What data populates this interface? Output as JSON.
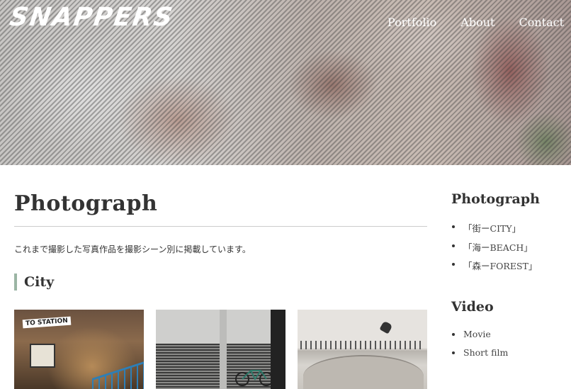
{
  "header": {
    "logo_text": "SNAPPERS",
    "nav": [
      "Portfolio",
      "About",
      "Contact"
    ]
  },
  "main": {
    "page_title": "Photograph",
    "intro": "これまで撮影した写真作品を撮影シーン別に掲載しています。",
    "section_title": "City",
    "photos": [
      {
        "sign_text": "TO STATION"
      },
      {},
      {}
    ]
  },
  "sidebar": {
    "sections": [
      {
        "title": "Photograph",
        "items": [
          "「街ーCITY」",
          "「海ーBEACH」",
          "「森ーFOREST」"
        ]
      },
      {
        "title": "Video",
        "items": [
          "Movie",
          "Short film"
        ]
      }
    ]
  },
  "colors": {
    "section_accent": "#9bb5a4",
    "text": "#333333",
    "nav_text": "#ffffff"
  }
}
